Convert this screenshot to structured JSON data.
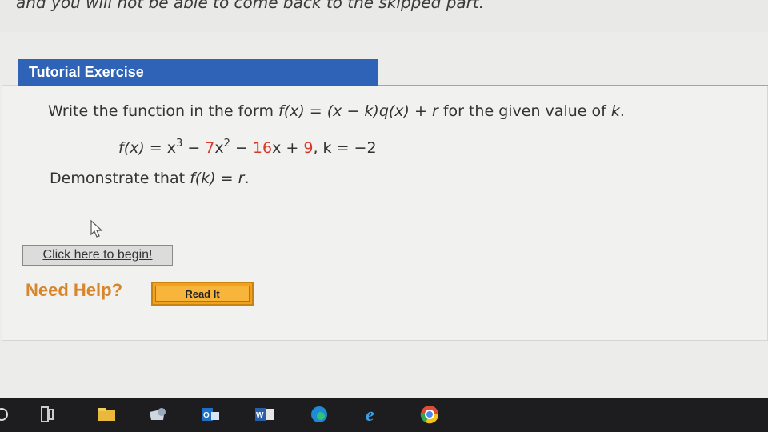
{
  "top_note": "and you will not be able to come back to the skipped part.",
  "tutorial": {
    "header": "Tutorial Exercise",
    "instruction_pre": "Write the function in the form ",
    "instruction_form": "f(x) = (x − k)q(x) + r",
    "instruction_post": " for the given value of ",
    "instruction_k": "k",
    "instruction_end": ".",
    "equation": {
      "fx": "f(x)",
      "eq": " = x",
      "exp3": "3",
      "minus1": " − ",
      "coef7": "7",
      "x2": "x",
      "exp2": "2",
      "minus2": " − ",
      "coef16": "16",
      "x1": "x + ",
      "const9": "9",
      "tail": ",  k = −2"
    },
    "demonstrate_pre": "Demonstrate that ",
    "demonstrate_expr": "f(k) = r",
    "demonstrate_end": "."
  },
  "begin_button": "Click here to begin!",
  "need_help": "Need Help?",
  "read_it": "Read It",
  "taskbar": {
    "icons": [
      "start-button",
      "task-view-icon",
      "file-explorer-icon",
      "store-icon",
      "outlook-icon",
      "word-icon",
      "edge-icon",
      "internet-explorer-icon",
      "chrome-icon"
    ]
  }
}
